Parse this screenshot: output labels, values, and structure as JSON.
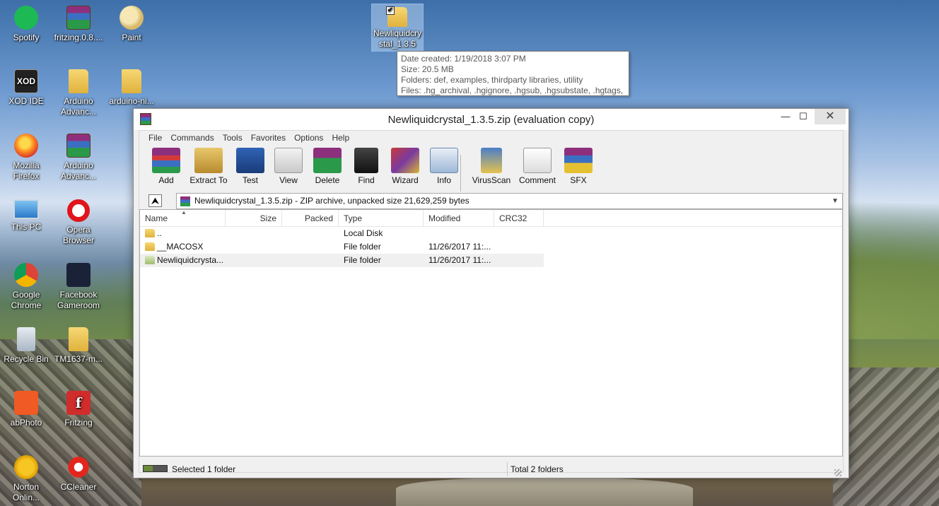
{
  "desktop": {
    "icons": [
      {
        "label": "Spotify",
        "icon": "spotify-icon"
      },
      {
        "label": "fritzing.0.8....",
        "icon": "winrar-icon"
      },
      {
        "label": "Paint",
        "icon": "paint-icon"
      },
      {
        "label": "XOD IDE",
        "icon": "xod-icon",
        "glyph": "XOD"
      },
      {
        "label": "Arduino Advanc...",
        "icon": "folder-icon"
      },
      {
        "label": "arduino-ni...",
        "icon": "folder-icon"
      },
      {
        "label": "Mozilla Firefox",
        "icon": "firefox-icon"
      },
      {
        "label": "Arduino Advanc...",
        "icon": "winrar-icon"
      },
      {
        "label": "This PC",
        "icon": "computer-icon"
      },
      {
        "label": "Opera Browser",
        "icon": "opera-icon"
      },
      {
        "label": "Google Chrome",
        "icon": "chrome-icon"
      },
      {
        "label": "Facebook Gameroom",
        "icon": "facebook-gameroom-icon"
      },
      {
        "label": "Recycle Bin",
        "icon": "recycle-bin-icon"
      },
      {
        "label": "TM1637-m...",
        "icon": "folder-icon"
      },
      {
        "label": "abPhoto",
        "icon": "abphoto-icon"
      },
      {
        "label": "Fritzing",
        "icon": "fritzing-icon",
        "glyph": "f"
      },
      {
        "label": "Norton Onlin...",
        "icon": "norton-icon"
      },
      {
        "label": "CCleaner",
        "icon": "ccleaner-icon"
      }
    ],
    "selected_icon": {
      "label": "Newliquidcrystal_1.3.5",
      "icon": "folder-icon"
    }
  },
  "tooltip": {
    "date_created": "Date created: 1/19/2018 3:07 PM",
    "size": "Size: 20.5 MB",
    "folders": "Folders: def, examples, thirdparty libraries, utility",
    "files": "Files: .hg_archival, .hgignore, .hgsub, .hgsubstate, .hgtags, ..."
  },
  "window": {
    "title": "Newliquidcrystal_1.3.5.zip (evaluation copy)",
    "controls": {
      "minimize": "—",
      "maximize": "☐",
      "close": "✕"
    },
    "menu": [
      "File",
      "Commands",
      "Tools",
      "Favorites",
      "Options",
      "Help"
    ],
    "toolbar": [
      {
        "label": "Add",
        "icon": "add-icon"
      },
      {
        "label": "Extract To",
        "icon": "extract-icon"
      },
      {
        "label": "Test",
        "icon": "test-icon"
      },
      {
        "label": "View",
        "icon": "view-icon"
      },
      {
        "label": "Delete",
        "icon": "delete-icon"
      },
      {
        "label": "Find",
        "icon": "find-icon"
      },
      {
        "label": "Wizard",
        "icon": "wizard-icon"
      },
      {
        "label": "Info",
        "icon": "info-icon"
      },
      {
        "label": "VirusScan",
        "icon": "virusscan-icon"
      },
      {
        "label": "Comment",
        "icon": "comment-icon"
      },
      {
        "label": "SFX",
        "icon": "sfx-icon"
      }
    ],
    "address": "Newliquidcrystal_1.3.5.zip - ZIP archive, unpacked size 21,629,259 bytes",
    "columns": [
      "Name",
      "Size",
      "Packed",
      "Type",
      "Modified",
      "CRC32"
    ],
    "rows": [
      {
        "name": "..",
        "size": "",
        "packed": "",
        "type": "Local Disk",
        "modified": "",
        "crc": ""
      },
      {
        "name": "__MACOSX",
        "size": "",
        "packed": "",
        "type": "File folder",
        "modified": "11/26/2017 11:...",
        "crc": ""
      },
      {
        "name": "Newliquidcrysta...",
        "size": "",
        "packed": "",
        "type": "File folder",
        "modified": "11/26/2017 11:...",
        "crc": ""
      }
    ],
    "status_left": "Selected 1 folder",
    "status_right": "Total 2 folders"
  }
}
